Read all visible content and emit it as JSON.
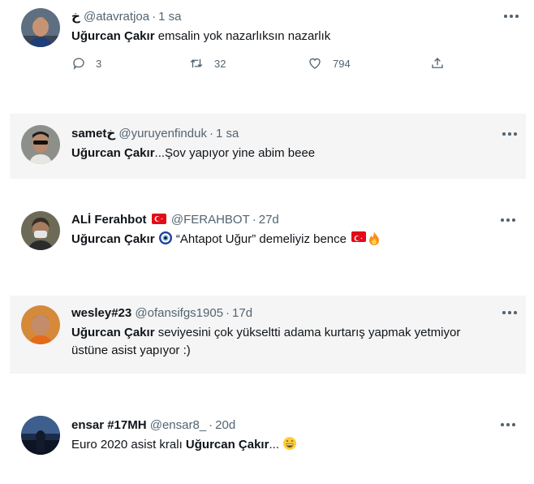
{
  "tweets": [
    {
      "name": "خ",
      "handle": "@atavratjoa",
      "time": "1 sa",
      "mention": "Uğurcan Çakır",
      "text_after": " emsalin yok nazarlıksın nazarlık",
      "reply_count": "3",
      "retweet_count": "32",
      "like_count": "794"
    },
    {
      "name": "samet",
      "name_suffix": "خ",
      "handle": "@yuruyenfinduk",
      "time": "1 sa",
      "mention": "Uğurcan Çakır",
      "text_after": "...Şov yapıyor yine abim beee"
    },
    {
      "name": "ALİ Ferahbot",
      "handle": "@FERAHBOT",
      "time": "27d",
      "mention": "Uğurcan Çakır",
      "text_after": " “Ahtapot Uğur” demeliyiz bence "
    },
    {
      "name": "wesley#23",
      "handle": "@ofansifgs1905",
      "time": "17d",
      "mention": "Uğurcan Çakır",
      "text_after": " seviyesini çok yükseltti adama kurtarış yapmak yetmiyor",
      "text_line2": "üstüne asist yapıyor :)"
    },
    {
      "name": "ensar #17MH",
      "handle": "@ensar8_",
      "time": "20d",
      "text_before": "Euro 2020 asist kralı ",
      "mention": "Uğurcan Çakır",
      "text_after": "... "
    }
  ],
  "colors": {
    "text": "#0f1419",
    "secondary": "#536471",
    "shaded_bg": "#f5f5f5",
    "flag_red": "#e30a17"
  },
  "icons": [
    "reply-icon",
    "retweet-icon",
    "like-icon",
    "share-icon",
    "more-icon",
    "turkish-flag-icon",
    "evil-eye-icon",
    "fire-icon",
    "grin-emoji-icon"
  ]
}
